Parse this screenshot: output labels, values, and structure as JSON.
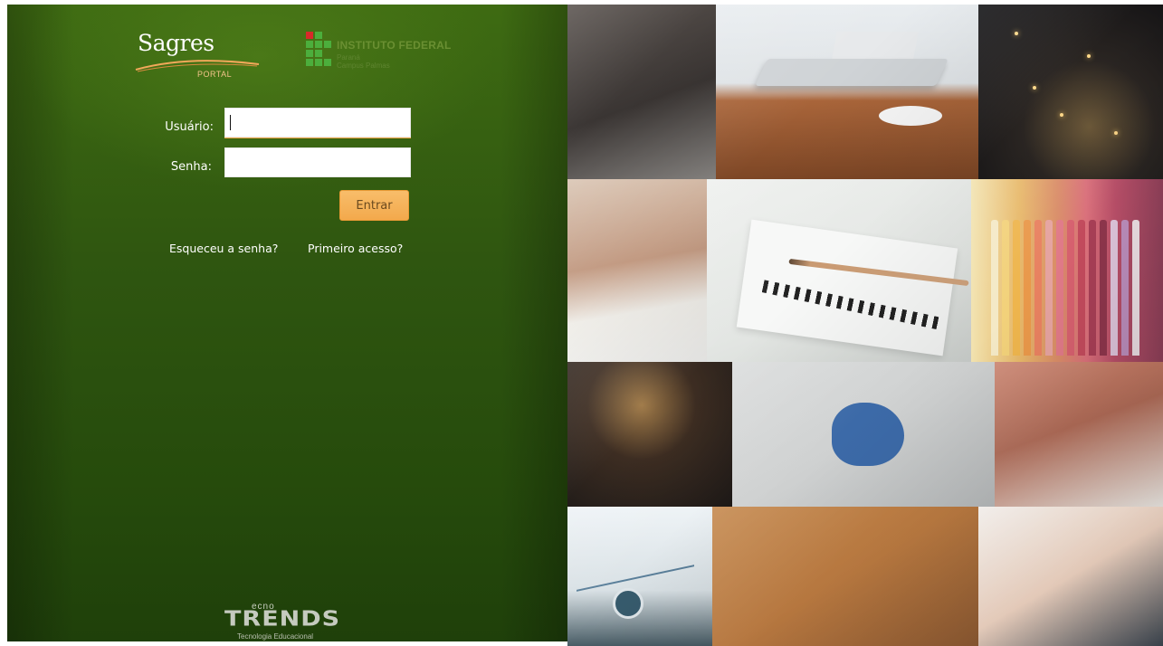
{
  "branding": {
    "sagres_word": "Sagres",
    "sagres_portal": "PORTAL",
    "institution_title": "INSTITUTO FEDERAL",
    "institution_state": "Paraná",
    "institution_campus": "Campus Palmas",
    "footer_small": "ecno",
    "footer_big": "TRENDS",
    "footer_sub": "Tecnologia Educacional"
  },
  "login": {
    "user_label": "Usuário:",
    "user_value": "",
    "password_label": "Senha:",
    "password_value": "",
    "submit_label": "Entrar",
    "forgot_link": "Esqueceu a senha?",
    "first_access_link": "Primeiro acesso?"
  },
  "colors": {
    "panel_green": "#2f5610",
    "button_orange": "#f3a94c",
    "link_white": "#ffffff"
  },
  "collage": {
    "tiles": [
      "photo-workspace",
      "photo-laptop-glasses",
      "photo-city-night",
      "photo-books",
      "photo-notebook-pencil",
      "photo-colored-pencils",
      "photo-typing-candle",
      "photo-paper-lightbulb",
      "photo-tablet-hand",
      "photo-chart-screen",
      "photo-desk-phone",
      "photo-drawing-tablet"
    ]
  }
}
